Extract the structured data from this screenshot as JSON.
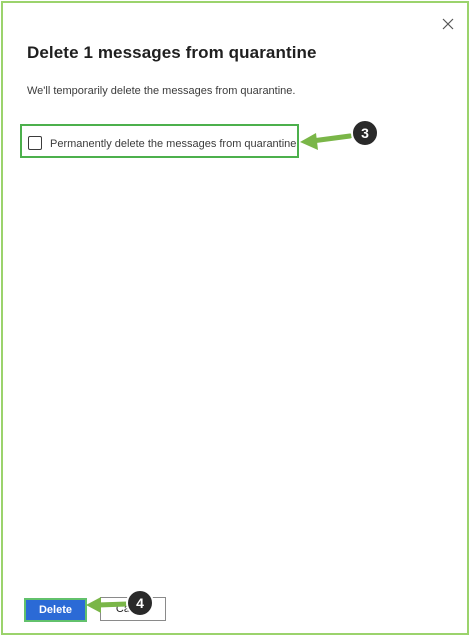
{
  "dialog": {
    "title": "Delete 1 messages from quarantine",
    "description": "We'll temporarily delete the messages from quarantine.",
    "checkbox_label": "Permanently delete the messages from quarantine",
    "checkbox_checked": false,
    "close_icon": "close-icon"
  },
  "buttons": {
    "delete_label": "Delete",
    "cancel_label": "Cancel"
  },
  "callouts": {
    "step_checkbox": "3",
    "step_delete": "4"
  },
  "colors": {
    "primary_button": "#2b6ad6",
    "callout_green": "#4cb04c",
    "frame_green": "#9bd36c",
    "badge": "#2a2a2a"
  }
}
